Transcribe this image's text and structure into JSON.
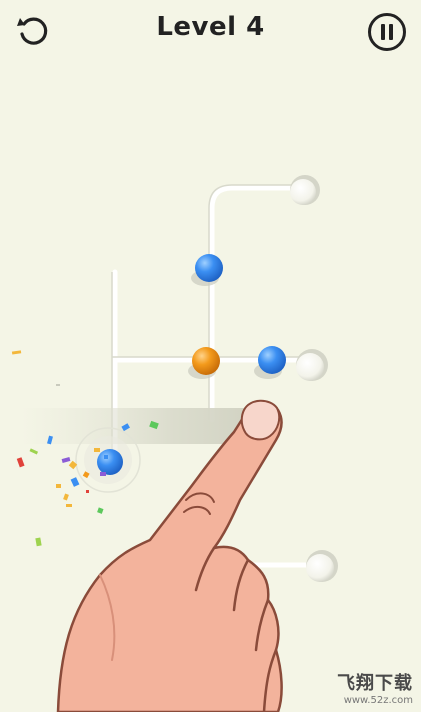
{
  "header": {
    "title": "Level 4"
  },
  "icons": {
    "restart": "restart-icon",
    "pause": "pause-icon"
  },
  "board": {
    "balls": [
      {
        "color": "blue",
        "hex": "#3b8ff2"
      },
      {
        "color": "orange",
        "hex": "#f39a1b"
      },
      {
        "color": "blue",
        "hex": "#3b8ff2"
      },
      {
        "color": "blue",
        "hex": "#3b8ff2"
      }
    ],
    "holes": 3
  },
  "colors": {
    "background": "#f4f5e6",
    "blue_ball": "#3b8ff2",
    "orange_ball": "#f39a1b",
    "skin": "#f3b39c",
    "skin_outline": "#8a4b3a"
  },
  "watermark": {
    "brand": "飞翔下载",
    "url": "www.52z.com"
  }
}
